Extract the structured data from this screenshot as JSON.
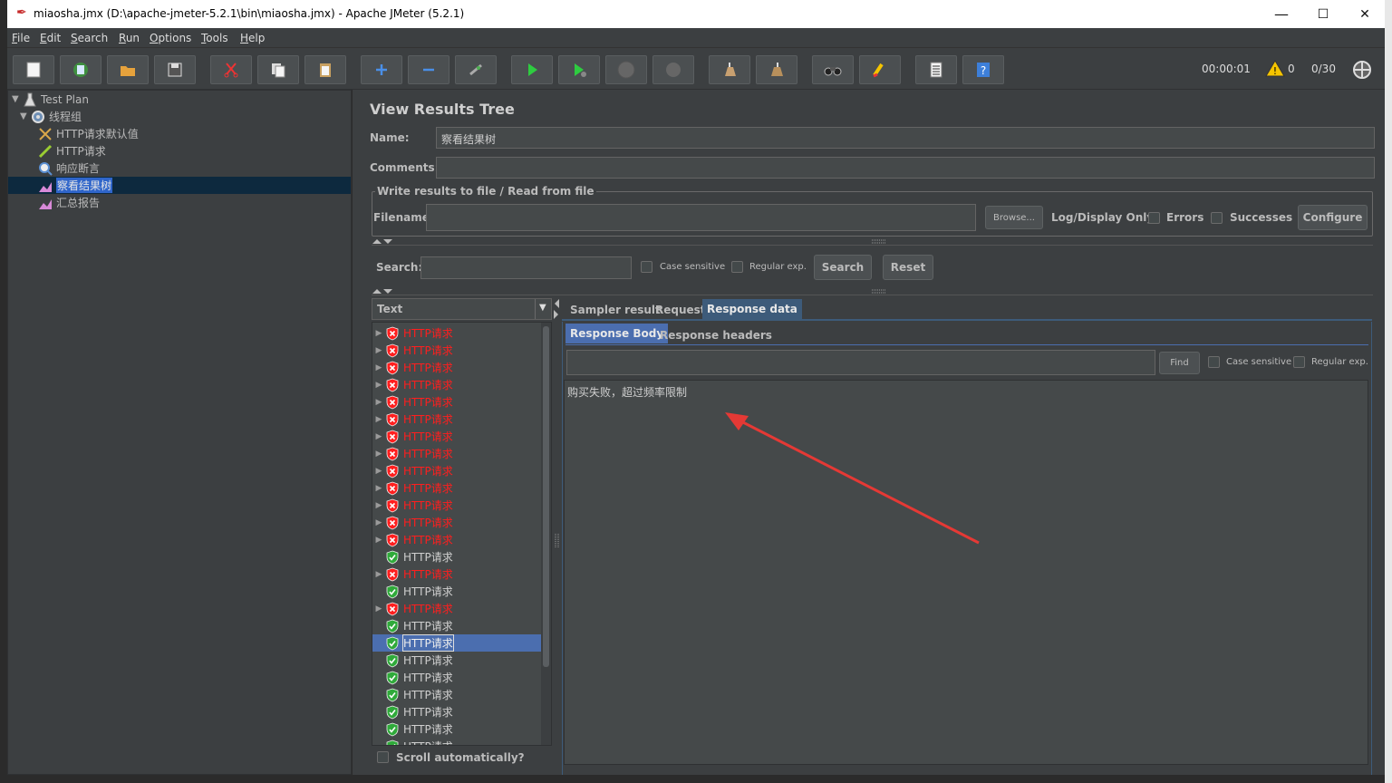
{
  "window": {
    "title": "miaosha.jmx (D:\\apache-jmeter-5.2.1\\bin\\miaosha.jmx) - Apache JMeter (5.2.1)",
    "minimize": "—",
    "maximize": "☐",
    "close": "✕"
  },
  "menu": [
    "File",
    "Edit",
    "Search",
    "Run",
    "Options",
    "Tools",
    "Help"
  ],
  "toolbar": {
    "icons": [
      "new-icon",
      "templates-icon",
      "open-icon",
      "save-icon",
      "cut-icon",
      "copy-icon",
      "paste-icon",
      "expand-icon",
      "collapse-icon",
      "toggle-icon",
      "start-icon",
      "start-no-pause-icon",
      "stop-icon",
      "shutdown-icon",
      "clear-icon",
      "clear-all-icon",
      "search-icon",
      "reset-search-icon",
      "function-helper-icon",
      "help-icon"
    ],
    "elapsed": "00:00:01",
    "warnings": "0",
    "threads": "0/30"
  },
  "tree": {
    "items": [
      {
        "label": "Test Plan",
        "icon": "test-plan-icon"
      },
      {
        "label": "线程组",
        "icon": "thread-group-icon"
      },
      {
        "label": "HTTP请求默认值",
        "icon": "config-icon"
      },
      {
        "label": "HTTP请求",
        "icon": "sampler-icon"
      },
      {
        "label": "响应断言",
        "icon": "assertion-icon"
      },
      {
        "label": "察看结果树",
        "icon": "listener-icon"
      },
      {
        "label": "汇总报告",
        "icon": "listener-icon"
      }
    ]
  },
  "panel": {
    "title": "View Results Tree",
    "name_label": "Name:",
    "name_value": "察看结果树",
    "comments_label": "Comments:",
    "comments_value": "",
    "file_group_title": "Write results to file / Read from file",
    "filename_label": "Filename",
    "filename_value": "",
    "browse": "Browse...",
    "log_display_only": "Log/Display Only:",
    "errors": "Errors",
    "successes": "Successes",
    "configure": "Configure",
    "search_label": "Search:",
    "search_value": "",
    "case_sensitive": "Case sensitive",
    "regular_exp": "Regular exp.",
    "search_button": "Search",
    "reset_button": "Reset",
    "renderer": "Text",
    "scroll_auto": "Scroll automatically?"
  },
  "results": [
    {
      "label": "HTTP请求",
      "status": "error"
    },
    {
      "label": "HTTP请求",
      "status": "error"
    },
    {
      "label": "HTTP请求",
      "status": "error"
    },
    {
      "label": "HTTP请求",
      "status": "error"
    },
    {
      "label": "HTTP请求",
      "status": "error"
    },
    {
      "label": "HTTP请求",
      "status": "error"
    },
    {
      "label": "HTTP请求",
      "status": "error"
    },
    {
      "label": "HTTP请求",
      "status": "error"
    },
    {
      "label": "HTTP请求",
      "status": "error"
    },
    {
      "label": "HTTP请求",
      "status": "error"
    },
    {
      "label": "HTTP请求",
      "status": "error"
    },
    {
      "label": "HTTP请求",
      "status": "error"
    },
    {
      "label": "HTTP请求",
      "status": "error"
    },
    {
      "label": "HTTP请求",
      "status": "ok"
    },
    {
      "label": "HTTP请求",
      "status": "error"
    },
    {
      "label": "HTTP请求",
      "status": "ok"
    },
    {
      "label": "HTTP请求",
      "status": "error"
    },
    {
      "label": "HTTP请求",
      "status": "ok"
    },
    {
      "label": "HTTP请求",
      "status": "ok",
      "selected": true
    },
    {
      "label": "HTTP请求",
      "status": "ok"
    },
    {
      "label": "HTTP请求",
      "status": "ok"
    },
    {
      "label": "HTTP请求",
      "status": "ok"
    },
    {
      "label": "HTTP请求",
      "status": "ok"
    },
    {
      "label": "HTTP请求",
      "status": "ok"
    },
    {
      "label": "HTTP请求",
      "status": "ok"
    }
  ],
  "tabs": {
    "top": [
      "Sampler result",
      "Request",
      "Response data"
    ],
    "sub": [
      "Response Body",
      "Response headers"
    ]
  },
  "response": {
    "find_value": "",
    "find_button": "Find",
    "case_sensitive": "Case sensitive",
    "regular_exp": "Regular exp.",
    "body": "购买失败，超过频率限制"
  },
  "colors": {
    "error": "#ff1e1e",
    "ok_shield": "#2faa3a",
    "selected": "#4b6eaf",
    "annotation_arrow": "#e53935"
  }
}
